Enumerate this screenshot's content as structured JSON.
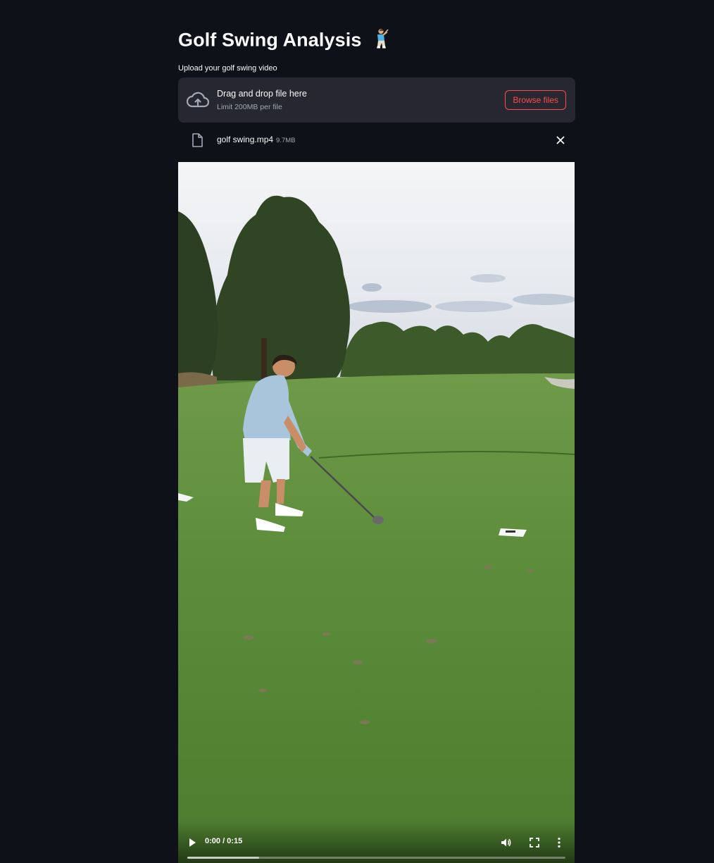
{
  "page": {
    "title": "Golf Swing Analysis"
  },
  "uploader": {
    "label": "Upload your golf swing video",
    "drop_text": "Drag and drop file here",
    "limit_text": "Limit 200MB per file",
    "browse_label": "Browse files",
    "icon": "cloud-upload-icon"
  },
  "file": {
    "name": "golf swing.mp4",
    "size": "9.7MB",
    "icon": "file-icon"
  },
  "video": {
    "time": "0:00 / 0:15",
    "buffered_fraction": 0.19,
    "played_fraction": 0.0
  },
  "colors": {
    "background": "#0e1117",
    "panel": "#262730",
    "accent": "#ff4b4b",
    "muted_text": "#a3a8b8"
  }
}
